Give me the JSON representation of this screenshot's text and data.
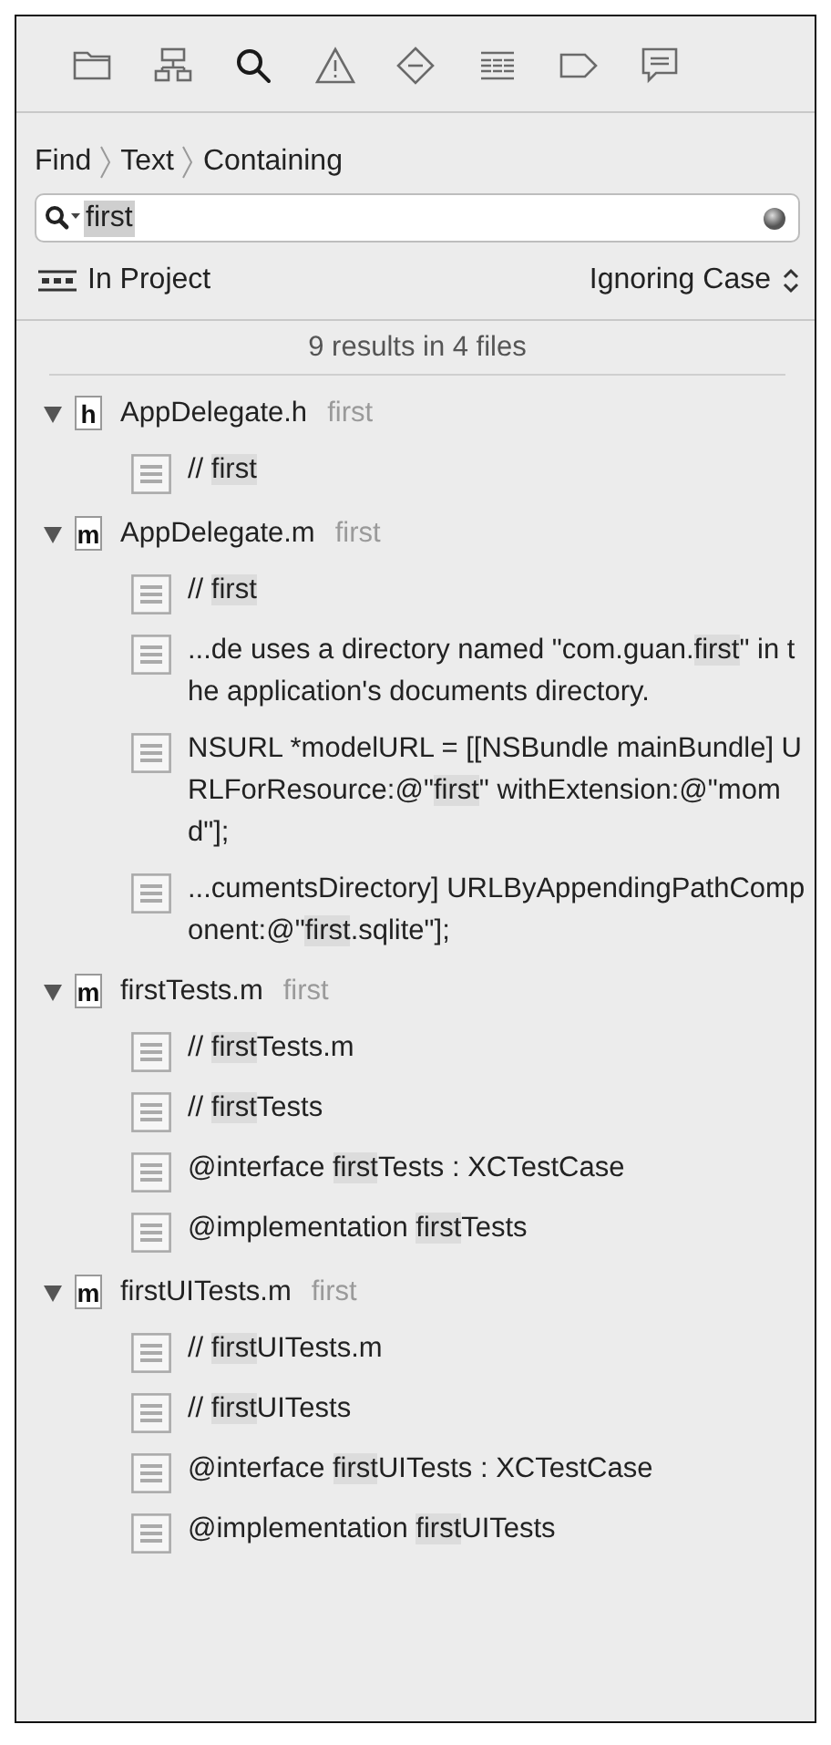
{
  "navigator_tabs": [
    {
      "kind": "folder",
      "selected": false
    },
    {
      "kind": "hierarchy",
      "selected": false
    },
    {
      "kind": "search",
      "selected": true
    },
    {
      "kind": "warning",
      "selected": false
    },
    {
      "kind": "diamond",
      "selected": false
    },
    {
      "kind": "list",
      "selected": false
    },
    {
      "kind": "tag",
      "selected": false
    },
    {
      "kind": "bubble",
      "selected": false
    }
  ],
  "breadcrumb": [
    "Find",
    "Text",
    "Containing"
  ],
  "search": {
    "value": "first",
    "selected": true
  },
  "scope": {
    "label": "In Project",
    "case": "Ignoring Case"
  },
  "summary": "9 results in 4 files",
  "files": [
    {
      "badge": "h",
      "name": "AppDelegate.h",
      "hint": "first",
      "expanded": true,
      "matches": [
        [
          {
            "text": "//  ",
            "hit": false
          },
          {
            "text": "first",
            "hit": true
          }
        ]
      ]
    },
    {
      "badge": "m",
      "name": "AppDelegate.m",
      "hint": "first",
      "expanded": true,
      "matches": [
        [
          {
            "text": "//  ",
            "hit": false
          },
          {
            "text": "first",
            "hit": true
          }
        ],
        [
          {
            "text": "...de uses a directory named \"com.guan.",
            "hit": false
          },
          {
            "text": "first",
            "hit": true
          },
          {
            "text": "\" in the application's documents directory.",
            "hit": false
          }
        ],
        [
          {
            "text": "NSURL *modelURL = [[NSBundle mainBundle] URLForResource:@\"",
            "hit": false
          },
          {
            "text": "first",
            "hit": true
          },
          {
            "text": "\" withExtension:@\"momd\"];",
            "hit": false
          }
        ],
        [
          {
            "text": "...cumentsDirectory] URLByAppendingPathComponent:@\"",
            "hit": false
          },
          {
            "text": "first",
            "hit": true
          },
          {
            "text": ".sqlite\"];",
            "hit": false
          }
        ]
      ]
    },
    {
      "badge": "m",
      "name": "firstTests.m",
      "hint": "first",
      "expanded": true,
      "matches": [
        [
          {
            "text": "//  ",
            "hit": false
          },
          {
            "text": "first",
            "hit": true
          },
          {
            "text": "Tests.m",
            "hit": false
          }
        ],
        [
          {
            "text": "//  ",
            "hit": false
          },
          {
            "text": "first",
            "hit": true
          },
          {
            "text": "Tests",
            "hit": false
          }
        ],
        [
          {
            "text": "@interface ",
            "hit": false
          },
          {
            "text": "first",
            "hit": true
          },
          {
            "text": "Tests : XCTestCase",
            "hit": false
          }
        ],
        [
          {
            "text": "@implementation ",
            "hit": false
          },
          {
            "text": "first",
            "hit": true
          },
          {
            "text": "Tests",
            "hit": false
          }
        ]
      ]
    },
    {
      "badge": "m",
      "name": "firstUITests.m",
      "hint": "first",
      "expanded": true,
      "matches": [
        [
          {
            "text": "//  ",
            "hit": false
          },
          {
            "text": "first",
            "hit": true
          },
          {
            "text": "UITests.m",
            "hit": false
          }
        ],
        [
          {
            "text": "//  ",
            "hit": false
          },
          {
            "text": "first",
            "hit": true
          },
          {
            "text": "UITests",
            "hit": false
          }
        ],
        [
          {
            "text": "@interface ",
            "hit": false
          },
          {
            "text": "first",
            "hit": true
          },
          {
            "text": "UITests : XCTestCase",
            "hit": false
          }
        ],
        [
          {
            "text": "@implementation ",
            "hit": false
          },
          {
            "text": "first",
            "hit": true
          },
          {
            "text": "UITests",
            "hit": false
          }
        ]
      ]
    }
  ]
}
